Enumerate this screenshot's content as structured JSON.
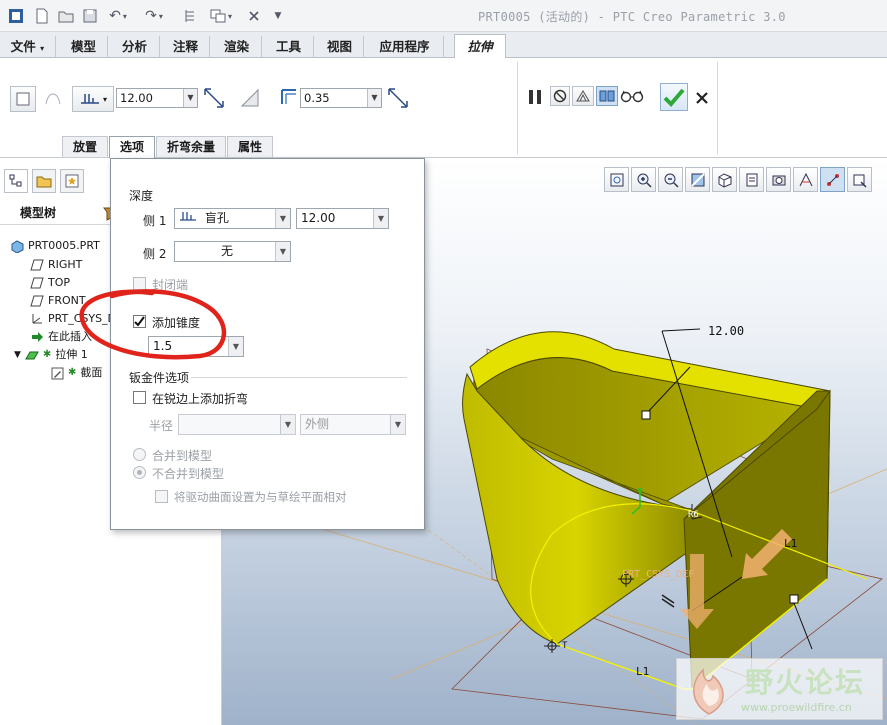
{
  "window": {
    "title": "PRT0005 (活动的) - PTC Creo Parametric 3.0"
  },
  "tabs": [
    "文件",
    "模型",
    "分析",
    "注释",
    "渲染",
    "工具",
    "视图",
    "应用程序",
    "拉伸"
  ],
  "ribbon": {
    "depth_value": "12.00",
    "thickness_value": "0.35",
    "subtabs": [
      "放置",
      "选项",
      "折弯余量",
      "属性"
    ]
  },
  "model_tree": {
    "header": "模型树",
    "items": [
      "PRT0005.PRT",
      "RIGHT",
      "TOP",
      "FRONT",
      "PRT_CSYS_DE",
      "在此插入",
      "拉伸 1",
      "截面"
    ]
  },
  "options": {
    "depth_title": "深度",
    "side1_label": "侧 1",
    "side1_type": "盲孔",
    "side1_value": "12.00",
    "side2_label": "侧 2",
    "side2_type": "无",
    "capped_ends_label": "封闭端",
    "add_taper_label": "添加锥度",
    "taper_value": "1.5",
    "sheetmetal_title": "钣金件选项",
    "add_bend_label": "在锐边上添加折弯",
    "radius_label": "半径",
    "radius_side": "外侧",
    "merge_label": "合并到模型",
    "no_merge_label": "不合并到模型",
    "drive_surface_label": "将驱动曲面设置为与草绘平面相对"
  },
  "viewport": {
    "dimension_label": "12.00",
    "csys_label": "PRT_CSYS_DEF",
    "line_labels": [
      "L1",
      "L1",
      "L1"
    ],
    "radius_tag": "R6",
    "tangent_tag": "T"
  },
  "watermark": {
    "title": "野火论坛",
    "url": "www.proewildfire.cn"
  },
  "colors": {
    "part_yellow": "#d8d400",
    "part_dark": "#6d6a00",
    "edge_yellow": "#f4f200",
    "confirm_green": "#2fa83a",
    "annotation_red": "#e0231b"
  }
}
